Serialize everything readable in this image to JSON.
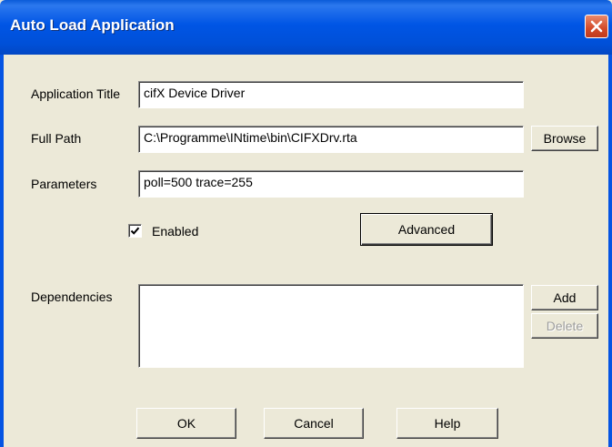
{
  "window": {
    "title": "Auto Load Application"
  },
  "form": {
    "app_title_label": "Application Title",
    "app_title_value": "cifX Device Driver",
    "full_path_label": "Full Path",
    "full_path_value": "C:\\Programme\\INtime\\bin\\CIFXDrv.rta",
    "parameters_label": "Parameters",
    "parameters_value": "poll=500 trace=255",
    "enabled_label": "Enabled",
    "enabled_checked": true,
    "dependencies_label": "Dependencies",
    "dependencies_items": []
  },
  "buttons": {
    "browse": "Browse",
    "advanced": "Advanced",
    "add": "Add",
    "delete": "Delete",
    "ok": "OK",
    "cancel": "Cancel",
    "help": "Help"
  },
  "icons": {
    "close": "close-icon",
    "check": "checkmark-icon"
  },
  "colors": {
    "titlebar": "#0055e5",
    "close_button": "#d34a28",
    "dialog_background": "#ece9d8"
  }
}
